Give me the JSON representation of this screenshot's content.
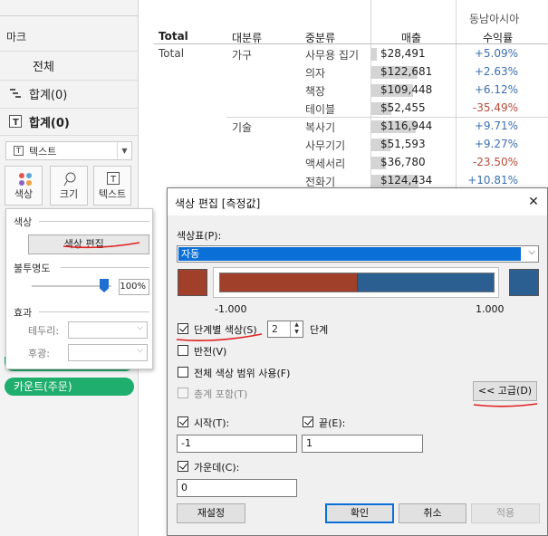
{
  "marks_panel": {
    "title": "마크",
    "rows": [
      {
        "label": "전체",
        "icon": "none"
      },
      {
        "label": "합계(0)",
        "icon": "gantt-bar-icon"
      },
      {
        "label": "합계(0)",
        "icon": "text-mark-icon"
      }
    ],
    "mark_type": "텍스트",
    "buttons": {
      "color": "색상",
      "size": "크기",
      "label": "텍스트"
    },
    "pills": [
      "카운트(주문)"
    ]
  },
  "color_popup": {
    "section_color": "색상",
    "edit_colors_button": "색상 편집...",
    "opacity_label": "불투명도",
    "opacity_value": "100%",
    "effects_label": "효과",
    "border_label": "테두리:",
    "halo_label": "후광:"
  },
  "table": {
    "region_header": "동남아시아",
    "col_headers": {
      "total": "Total",
      "category": "대분류",
      "subcategory": "중분류",
      "sales": "매출",
      "profit": "수익률"
    },
    "total_label": "Total",
    "groups": [
      {
        "category": "가구",
        "rows": [
          {
            "sub": "사무용 집기",
            "sales": "$28,491",
            "profit": "+5.09%",
            "bar": 0.11,
            "profit_color": "#3a6fb0"
          },
          {
            "sub": "의자",
            "sales": "$122,681",
            "profit": "+2.63%",
            "bar": 0.98,
            "profit_color": "#3a6fb0"
          },
          {
            "sub": "책장",
            "sales": "$109,448",
            "profit": "+6.12%",
            "bar": 0.88,
            "profit_color": "#3a6fb0"
          },
          {
            "sub": "테이블",
            "sales": "$52,455",
            "profit": "-35.49%",
            "bar": 0.42,
            "profit_color": "#b64a3a"
          }
        ]
      },
      {
        "category": "기술",
        "rows": [
          {
            "sub": "복사기",
            "sales": "$116,944",
            "profit": "+9.71%",
            "bar": 0.94,
            "profit_color": "#3a6fb0"
          },
          {
            "sub": "사무기기",
            "sales": "$51,593",
            "profit": "+9.27%",
            "bar": 0.41,
            "profit_color": "#3a6fb0"
          },
          {
            "sub": "액세서리",
            "sales": "$36,780",
            "profit": "-23.50%",
            "bar": 0.3,
            "profit_color": "#b64a3a"
          },
          {
            "sub": "전화기",
            "sales": "$124,434",
            "profit": "+10.81%",
            "bar": 1.0,
            "profit_color": "#3a6fb0"
          }
        ]
      }
    ]
  },
  "dialog": {
    "title": "색상 편집 [측정값]",
    "close_glyph": "✕",
    "palette_label": "색상표(P):",
    "palette_value": "자동",
    "min_color": "#a0402a",
    "max_color": "#2c5f91",
    "min_label": "-1.000",
    "max_label": "1.000",
    "stepped_label": "단계별 색상(S)",
    "stepped_checked": true,
    "steps_value": "2",
    "steps_unit": "단계",
    "reversed_label": "반전(V)",
    "full_range_label": "전체 색상 범위 사용(F)",
    "include_totals_label": "총계 포함(T)",
    "advanced_button": "<< 고급(D)",
    "start_label": "시작(T):",
    "start_value": "-1",
    "end_label": "끝(E):",
    "end_value": "1",
    "center_label": "가운데(C):",
    "center_value": "0",
    "reset_button": "재설정",
    "ok_button": "확인",
    "cancel_button": "취소",
    "apply_button": "적용"
  }
}
